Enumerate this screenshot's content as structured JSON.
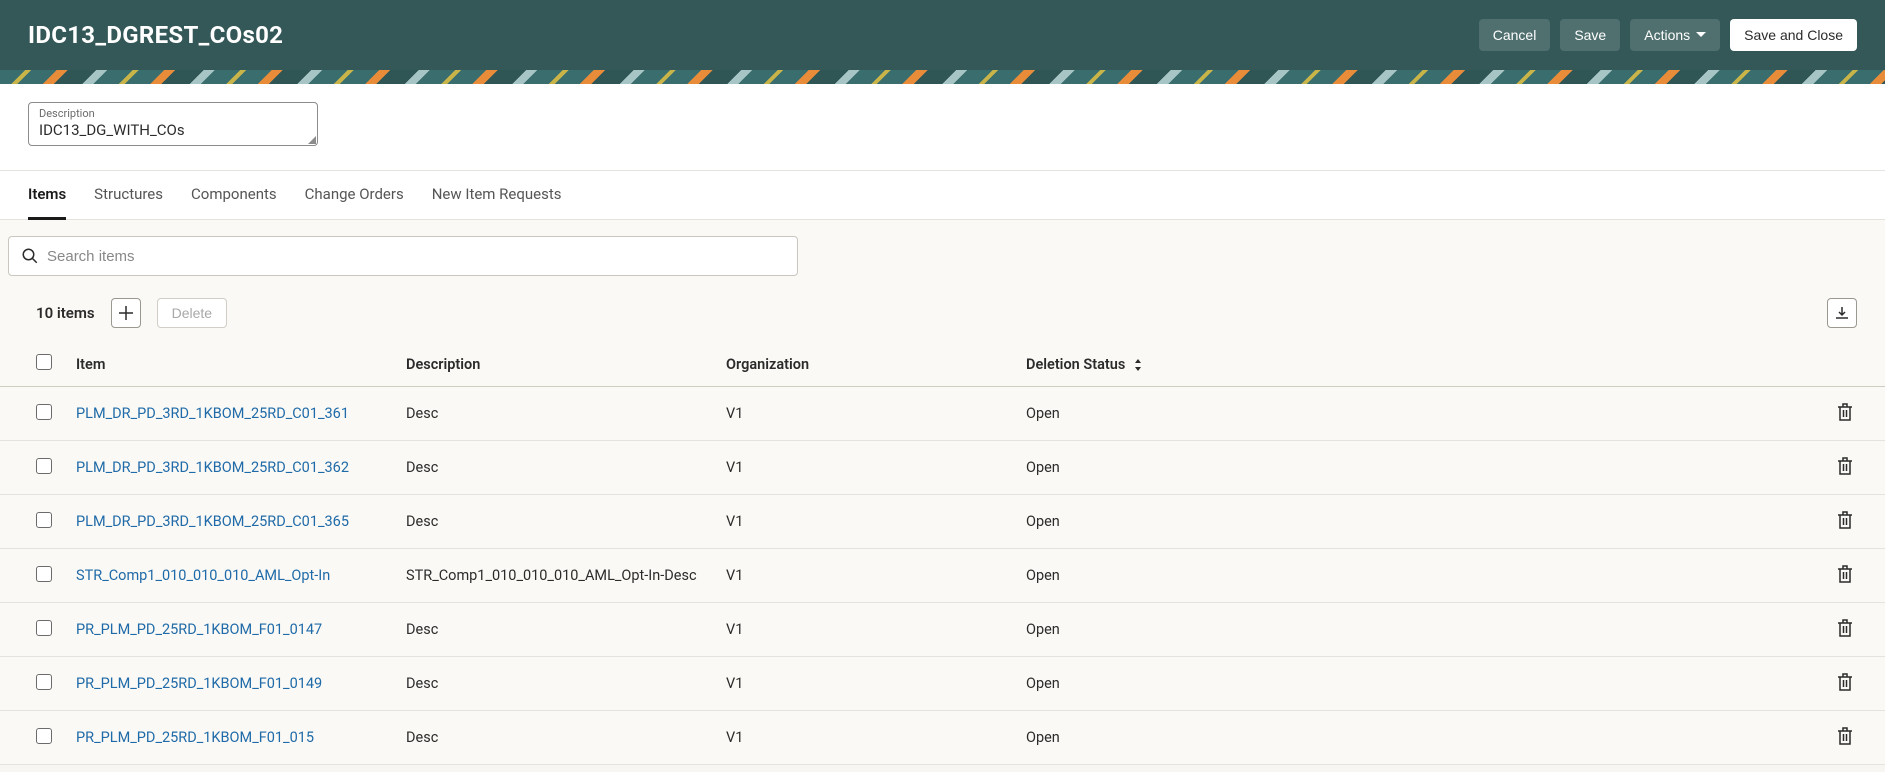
{
  "header": {
    "title": "IDC13_DGREST_COs02",
    "cancel": "Cancel",
    "save": "Save",
    "actions": "Actions",
    "saveClose": "Save and Close"
  },
  "description": {
    "label": "Description",
    "value": "IDC13_DG_WITH_COs"
  },
  "tabs": [
    {
      "label": "Items",
      "active": true
    },
    {
      "label": "Structures",
      "active": false
    },
    {
      "label": "Components",
      "active": false
    },
    {
      "label": "Change Orders",
      "active": false
    },
    {
      "label": "New Item Requests",
      "active": false
    }
  ],
  "search": {
    "placeholder": "Search items"
  },
  "tableTop": {
    "count": "10 items",
    "delete": "Delete"
  },
  "columns": {
    "item": "Item",
    "description": "Description",
    "organization": "Organization",
    "deletionStatus": "Deletion Status"
  },
  "rows": [
    {
      "item": "PLM_DR_PD_3RD_1KBOM_25RD_C01_361",
      "description": "Desc",
      "organization": "V1",
      "status": "Open"
    },
    {
      "item": "PLM_DR_PD_3RD_1KBOM_25RD_C01_362",
      "description": "Desc",
      "organization": "V1",
      "status": "Open"
    },
    {
      "item": "PLM_DR_PD_3RD_1KBOM_25RD_C01_365",
      "description": "Desc",
      "organization": "V1",
      "status": "Open"
    },
    {
      "item": "STR_Comp1_010_010_010_AML_Opt-In",
      "description": "STR_Comp1_010_010_010_AML_Opt-In-Desc",
      "organization": "V1",
      "status": "Open"
    },
    {
      "item": "PR_PLM_PD_25RD_1KBOM_F01_0147",
      "description": "Desc",
      "organization": "V1",
      "status": "Open"
    },
    {
      "item": "PR_PLM_PD_25RD_1KBOM_F01_0149",
      "description": "Desc",
      "organization": "V1",
      "status": "Open"
    },
    {
      "item": "PR_PLM_PD_25RD_1KBOM_F01_015",
      "description": "Desc",
      "organization": "V1",
      "status": "Open"
    }
  ]
}
